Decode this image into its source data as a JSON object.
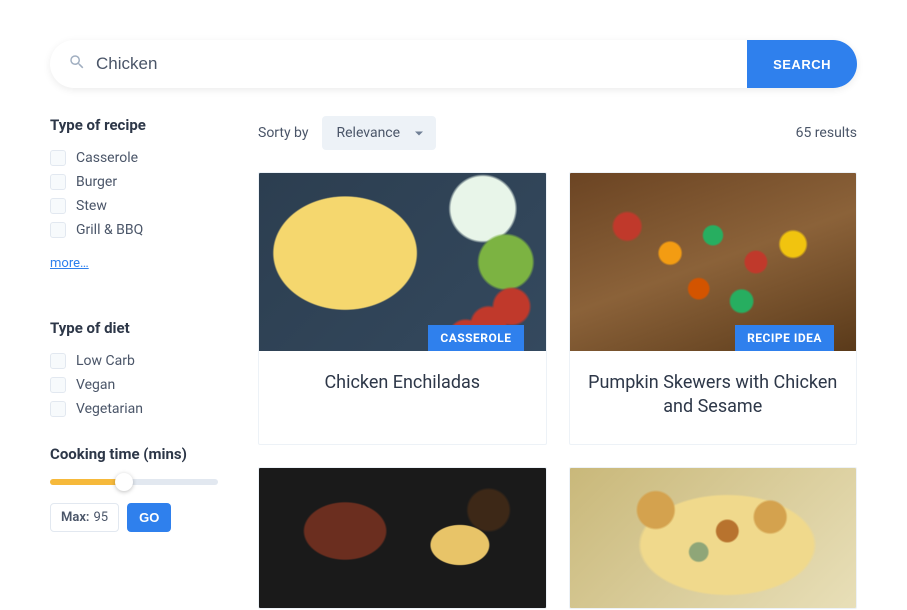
{
  "search": {
    "value": "Chicken",
    "button_label": "SEARCH"
  },
  "sidebar": {
    "recipe_type": {
      "heading": "Type of recipe",
      "options": [
        "Casserole",
        "Burger",
        "Stew",
        "Grill & BBQ"
      ],
      "more_label": "more…"
    },
    "diet_type": {
      "heading": "Type of diet",
      "options": [
        "Low Carb",
        "Vegan",
        "Vegetarian"
      ]
    },
    "cooking_time": {
      "heading": "Cooking time (mins)",
      "max_label": "Max:",
      "max_value": "95",
      "go_label": "GO"
    }
  },
  "content": {
    "sort_label": "Sorty by",
    "sort_value": "Relevance",
    "results_text": "65 results",
    "cards": [
      {
        "badge": "CASSEROLE",
        "title": "Chicken Enchiladas"
      },
      {
        "badge": "RECIPE IDEA",
        "title": "Pumpkin Skewers with Chicken and Sesame"
      }
    ]
  }
}
